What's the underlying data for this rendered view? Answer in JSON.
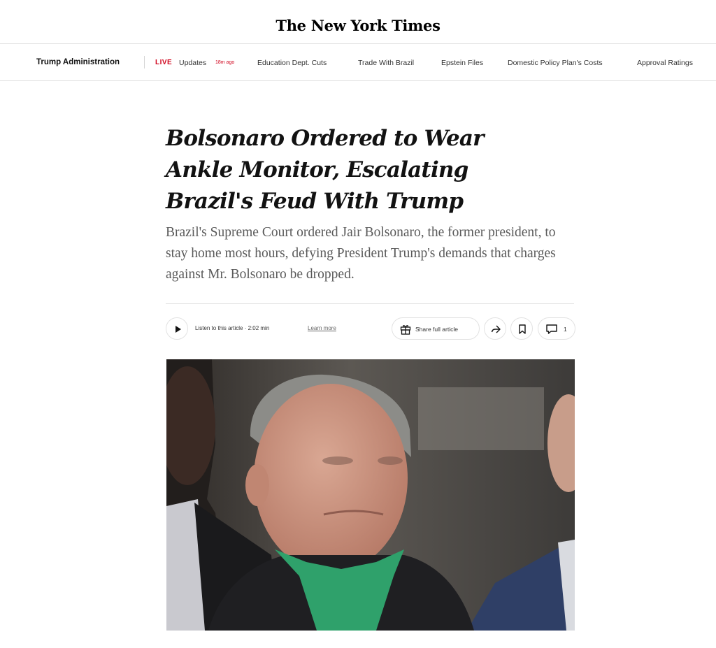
{
  "masthead": {
    "logo": "The New York Times"
  },
  "nav": {
    "section": "Trump Administration",
    "live": "LIVE",
    "updates": "Updates",
    "updates_time": "18m ago",
    "links": [
      "Education Dept. Cuts",
      "Trade With Brazil",
      "Epstein Files",
      "Domestic Policy Plan's Costs",
      "Approval Ratings"
    ]
  },
  "article": {
    "headline": "Bolsonaro Ordered to Wear Ankle Monitor, Escalating Brazil's Feud With Trump",
    "summary": "Brazil's Supreme Court ordered Jair Bolsonaro, the former president, to stay home most hours, defying President Trump's demands that charges against Mr. Bolsonaro be dropped."
  },
  "toolbar": {
    "listen": "Listen to this article · 2:02 min",
    "learn_more": "Learn more",
    "share": "Share full article",
    "comment_count": "1"
  },
  "icons": {
    "play": "play-icon",
    "share_gift": "gift-icon",
    "share": "share-arrow-icon",
    "save": "bookmark-icon",
    "comments": "comment-icon"
  },
  "colors": {
    "live_red": "#d0021b",
    "text": "#121212",
    "summary_gray": "#5a5a5a"
  }
}
